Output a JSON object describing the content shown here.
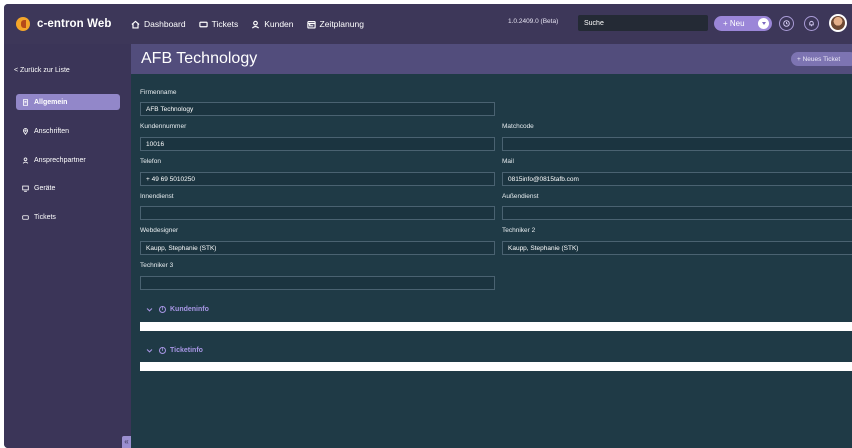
{
  "brand": {
    "name": "c-entron Web"
  },
  "nav": [
    {
      "label": "Dashboard",
      "icon": "home-icon"
    },
    {
      "label": "Tickets",
      "icon": "ticket-icon"
    },
    {
      "label": "Kunden",
      "icon": "user-icon"
    },
    {
      "label": "Zeitplanung",
      "icon": "calendar-icon"
    }
  ],
  "version": "1.0.2409.0 (Beta)",
  "search": {
    "placeholder": "Suche"
  },
  "new_button": {
    "label": "+ Neu"
  },
  "sidebar": {
    "back": "< Zurück zur Liste",
    "items": [
      {
        "label": "Allgemein",
        "icon": "document-icon",
        "active": true
      },
      {
        "label": "Anschriften",
        "icon": "location-icon"
      },
      {
        "label": "Ansprechpartner",
        "icon": "person-icon"
      },
      {
        "label": "Geräte",
        "icon": "monitor-icon"
      },
      {
        "label": "Tickets",
        "icon": "ticket-icon"
      }
    ]
  },
  "page": {
    "title": "AFB Technology",
    "new_ticket": "+ Neues Ticket"
  },
  "form": {
    "firmenname": {
      "label": "Firmenname",
      "value": "AFB Technology"
    },
    "kundennummer": {
      "label": "Kundennummer",
      "value": "10016"
    },
    "matchcode": {
      "label": "Matchcode",
      "value": ""
    },
    "telefon": {
      "label": "Telefon",
      "value": "+ 49 69 5010250"
    },
    "mail": {
      "label": "Mail",
      "value": "0815info@0815tafb.com"
    },
    "innendienst": {
      "label": "Innendienst",
      "value": ""
    },
    "aussendienst": {
      "label": "Außendienst",
      "value": ""
    },
    "webdesigner": {
      "label": "Webdesigner",
      "value": "Kaupp, Stephanie (STK)"
    },
    "techniker2": {
      "label": "Techniker 2",
      "value": "Kaupp, Stephanie (STK)"
    },
    "techniker3": {
      "label": "Techniker 3",
      "value": ""
    }
  },
  "sections": {
    "kundeninfo": "Kundeninfo",
    "ticketinfo": "Ticketinfo"
  },
  "colors": {
    "topbar": "#3d3759",
    "sidebar": "#3b3558",
    "content": "#1f3a46",
    "accent": "#9b86d8"
  }
}
